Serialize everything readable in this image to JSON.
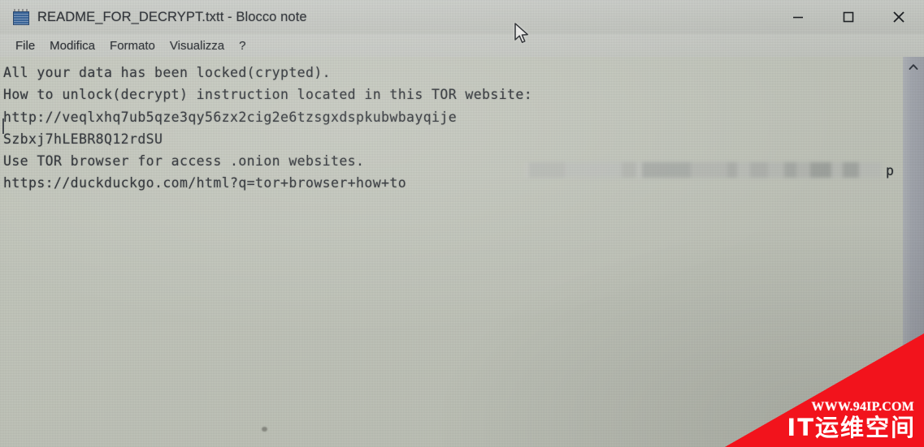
{
  "window": {
    "title": "README_FOR_DECRYPT.txtt - Blocco note",
    "app_icon": "notepad-icon",
    "controls": {
      "minimize": "—",
      "maximize": "□",
      "close": "✕"
    }
  },
  "menu": {
    "items": [
      {
        "label": "File"
      },
      {
        "label": "Modifica"
      },
      {
        "label": "Formato"
      },
      {
        "label": "Visualizza"
      },
      {
        "label": "?"
      }
    ]
  },
  "document": {
    "lines": [
      "All your data has been locked(crypted).",
      "How to unlock(decrypt) instruction located in this TOR website:",
      "http://veqlxhq7ub5qze3qy56zx2cig2e6tzsgxdspkubwbayqije",
      "Szbxj7hLEBR8Q12rdSU",
      "Use TOR browser for access .onion websites.",
      "https://duckduckgo.com/html?q=tor+browser+how+to"
    ],
    "redacted_tail": "p",
    "redaction_note": "blurred"
  },
  "scrollbar": {
    "up_arrow": "⌃"
  },
  "watermark": {
    "url": "WWW.94IP.COM",
    "name": "IT运维空间",
    "color": "#f2131c"
  },
  "colors": {
    "background": "#c7cbc0",
    "titlebar": "#c9ccc6",
    "text": "#22262b",
    "scrollbar_track": "#a8acb4"
  }
}
